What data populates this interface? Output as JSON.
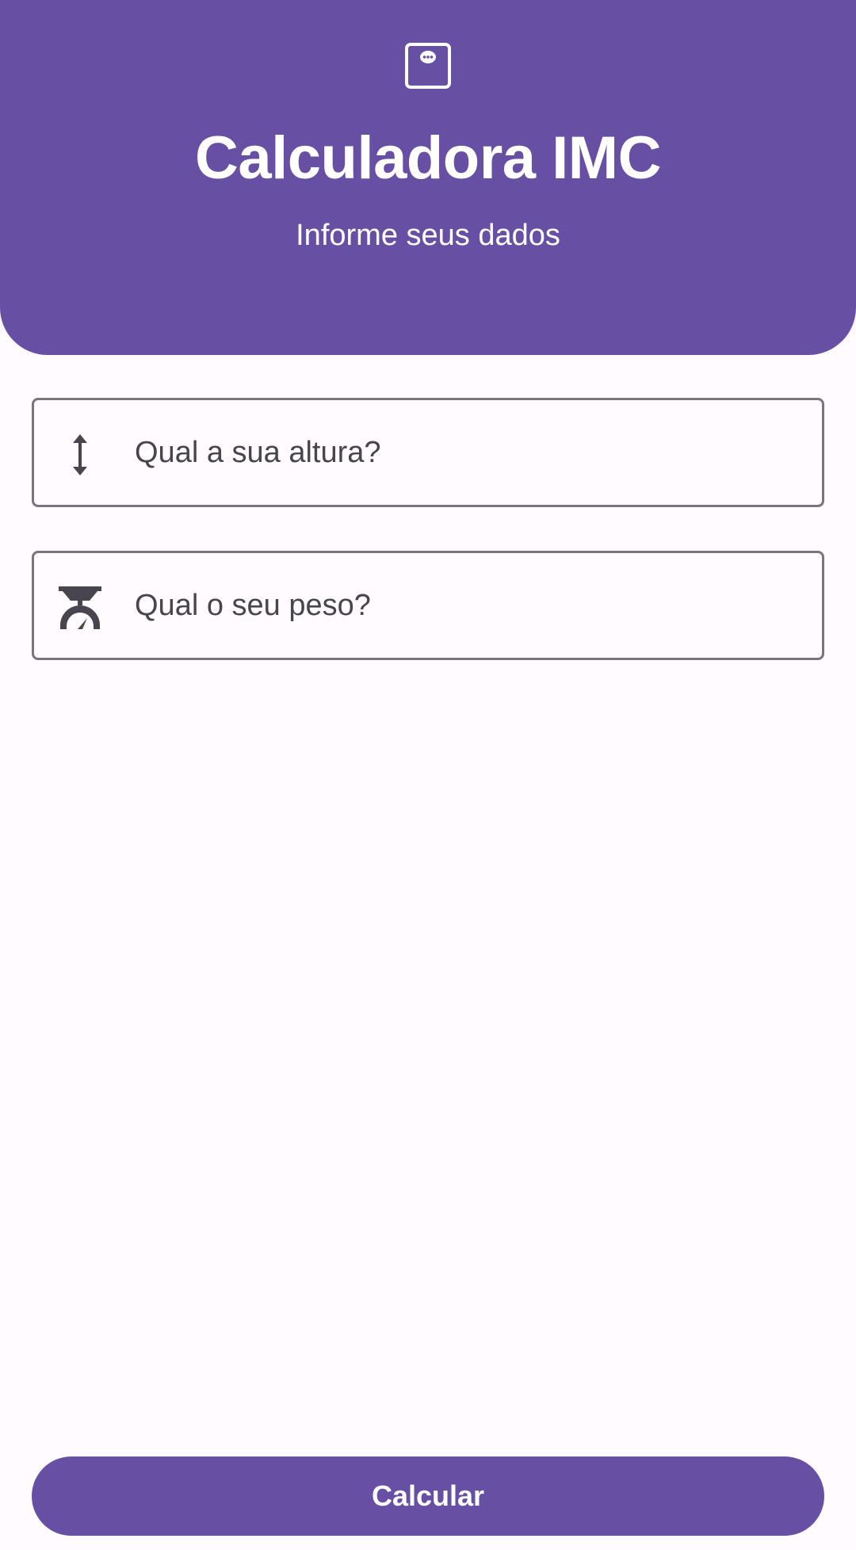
{
  "header": {
    "icon": "bathroom-scale-icon",
    "title": "Calculadora IMC",
    "subtitle": "Informe seus dados"
  },
  "form": {
    "height_field": {
      "icon": "vertical-arrows-icon",
      "placeholder": "Qual a sua altura?",
      "value": ""
    },
    "weight_field": {
      "icon": "kitchen-scale-icon",
      "placeholder": "Qual o seu peso?",
      "value": ""
    }
  },
  "actions": {
    "calculate_label": "Calcular"
  },
  "colors": {
    "primary": "#6750A4",
    "background": "#FFFBFE",
    "outline": "#79747E",
    "on_surface_variant": "#49454F"
  }
}
